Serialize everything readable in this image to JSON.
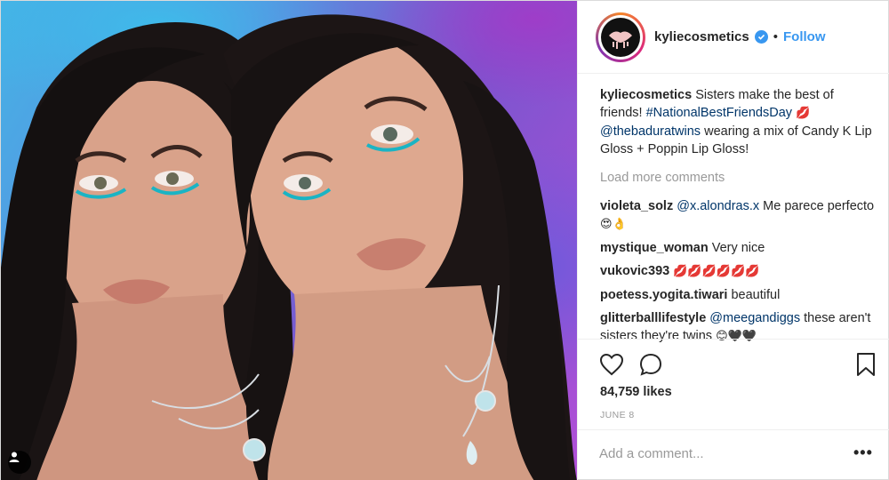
{
  "post": {
    "username": "kyliecosmetics",
    "follow_label": "Follow",
    "dot": "•",
    "caption": {
      "user": "kyliecosmetics",
      "text_a": " Sisters make the best of friends! ",
      "hashtag": "#NationalBestFriendsDay",
      "emoji_a": " 💋",
      "mention": "@thebaduratwins",
      "text_b": " wearing a mix of Candy K Lip Gloss + Poppin Lip Gloss!"
    },
    "load_more": "Load more comments",
    "comments": [
      {
        "user": "violeta_solz",
        "mention": "@x.alondras.x",
        "text": " Me parece perfecto ",
        "emoji": "😍👌"
      },
      {
        "user": "mystique_woman",
        "mention": "",
        "text": " Very nice",
        "emoji": ""
      },
      {
        "user": "vukovic393",
        "mention": "",
        "text": " ",
        "emoji": "💋💋💋💋💋💋"
      },
      {
        "user": "poetess.yogita.tiwari",
        "mention": "",
        "text": " beautiful",
        "emoji": ""
      },
      {
        "user": "glitterballlifestyle",
        "mention": "@meegandiggs",
        "text": " these aren't sisters they're twins ",
        "emoji": "😊🖤🖤"
      }
    ],
    "likes": "84,759 likes",
    "date": "JUNE 8",
    "comment_placeholder": "Add a comment...",
    "more_options": "•••",
    "icons": [
      "user-tag-icon",
      "verified-badge-icon",
      "heart-icon",
      "comment-icon",
      "bookmark-icon",
      "more-options-icon"
    ],
    "colors": {
      "link": "#3897f0",
      "mention": "#003569",
      "muted": "#999999",
      "text": "#262626"
    }
  }
}
